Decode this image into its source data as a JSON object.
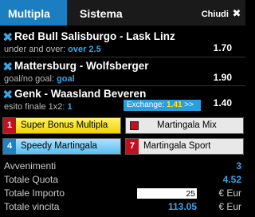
{
  "tabs": {
    "multipla": "Multipla",
    "sistema": "Sistema",
    "chiudi": "Chiudi",
    "close_glyph": "✖"
  },
  "bets": [
    {
      "event": "Red Bull Salisburgo - Lask Linz",
      "market": "under and over: ",
      "selection": "over 2.5",
      "odds": "1.70"
    },
    {
      "event": "Mattersburg - Wolfsberger",
      "market": "goal/no goal: ",
      "selection": "goal",
      "odds": "1.90"
    },
    {
      "event": "Genk - Waasland Beveren",
      "market": "esito finale 1x2: ",
      "selection": "1",
      "odds": "1.40"
    }
  ],
  "remove_glyph": "✖",
  "exchange": {
    "label": "Exchange: ",
    "value": "1.41",
    "arrow": " >>"
  },
  "buttons": {
    "super_bonus": {
      "num": "1",
      "label": "Super Bonus Multipla"
    },
    "martingala_mix": {
      "label": "Martingala Mix"
    },
    "speedy": {
      "num": "4",
      "label": "Speedy Martingala"
    },
    "martingala_sport": {
      "num": "7",
      "label": "Martingala Sport"
    }
  },
  "summary": {
    "avvenimenti_label": "Avvenimenti",
    "avvenimenti": "3",
    "quota_label": "Totale Quota",
    "quota": "4.52",
    "importo_label": "Totale Importo",
    "importo": "25",
    "importo_currency": "€ Eur",
    "vincita_label": "Totale vincita",
    "vincita": "113.05",
    "vincita_currency": "€ Eur"
  },
  "colors": {
    "accent": "#1a7ec0",
    "link": "#3da5e6",
    "bonus": "#f2d300",
    "red": "#c0111e"
  }
}
